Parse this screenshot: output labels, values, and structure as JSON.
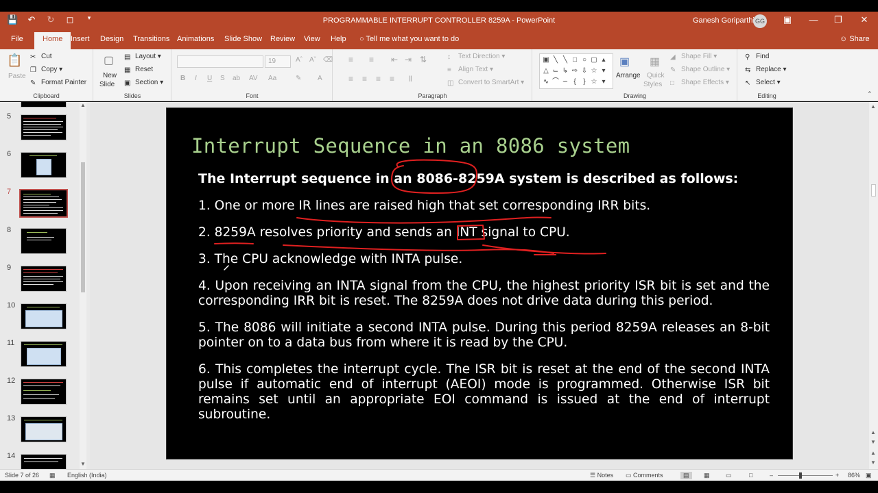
{
  "titlebar": {
    "document_title": "PROGRAMMABLE INTERRUPT CONTROLLER 8259A  -  PowerPoint",
    "user_name": "Ganesh Goriparthi",
    "user_initials": "GG"
  },
  "tabs": {
    "file": "File",
    "home": "Home",
    "insert": "Insert",
    "design": "Design",
    "transitions": "Transitions",
    "animations": "Animations",
    "slideshow": "Slide Show",
    "review": "Review",
    "view": "View",
    "help": "Help",
    "tell_me": "Tell me what you want to do",
    "share": "Share"
  },
  "ribbon": {
    "clipboard": {
      "label": "Clipboard",
      "paste": "Paste",
      "cut": "Cut",
      "copy": "Copy",
      "format_painter": "Format Painter"
    },
    "slides": {
      "label": "Slides",
      "new_slide_1": "New",
      "new_slide_2": "Slide",
      "layout": "Layout",
      "reset": "Reset",
      "section": "Section"
    },
    "font": {
      "label": "Font",
      "size": "19"
    },
    "paragraph": {
      "label": "Paragraph",
      "text_direction": "Text Direction",
      "align_text": "Align Text",
      "convert_smartart": "Convert to SmartArt"
    },
    "drawing": {
      "label": "Drawing",
      "arrange": "Arrange",
      "quick_styles_1": "Quick",
      "quick_styles_2": "Styles",
      "shape_fill": "Shape Fill",
      "shape_outline": "Shape Outline",
      "shape_effects": "Shape Effects"
    },
    "editing": {
      "label": "Editing",
      "find": "Find",
      "replace": "Replace",
      "select": "Select"
    }
  },
  "thumbnails": {
    "numbers": [
      "5",
      "6",
      "7",
      "8",
      "9",
      "10",
      "11",
      "12",
      "13",
      "14"
    ],
    "active": "7"
  },
  "slide": {
    "title": "Interrupt Sequence in an 8086 system",
    "subtitle_before": "The Interrupt sequence in an ",
    "subtitle_highlight": "8086-8259A",
    "subtitle_after": " system is described as follows:",
    "point1": "1. One or more IR lines are raised high that set corresponding IRR bits.",
    "point2_before": "2. 8259A resolves priority and sends an ",
    "point2_highlight": "INT",
    "point2_after": " signal to CPU.",
    "point3": "3. The CPU acknowledge with INTA pulse.",
    "point4": "4. Upon receiving an INTA signal from the CPU, the highest priority ISR bit is set and the corresponding IRR bit is reset. The 8259A does not drive data during this period.",
    "point5": "5. The 8086 will initiate a second INTA pulse. During this period 8259A releases an 8-bit pointer on to a data bus from where it is read by the CPU.",
    "point6": "6. This completes the interrupt cycle. The ISR bit is reset at the end of the second INTA pulse if automatic end of interrupt (AEOI) mode is programmed. Otherwise ISR bit remains set until an appropriate EOI command is issued at the end of interrupt subroutine."
  },
  "status": {
    "slide_count": "Slide 7 of 26",
    "language": "English (India)",
    "notes": "Notes",
    "comments": "Comments",
    "zoom": "86%"
  },
  "colors": {
    "accent": "#b7472a",
    "slide_title": "#a8d08d",
    "ink": "#e02020"
  }
}
